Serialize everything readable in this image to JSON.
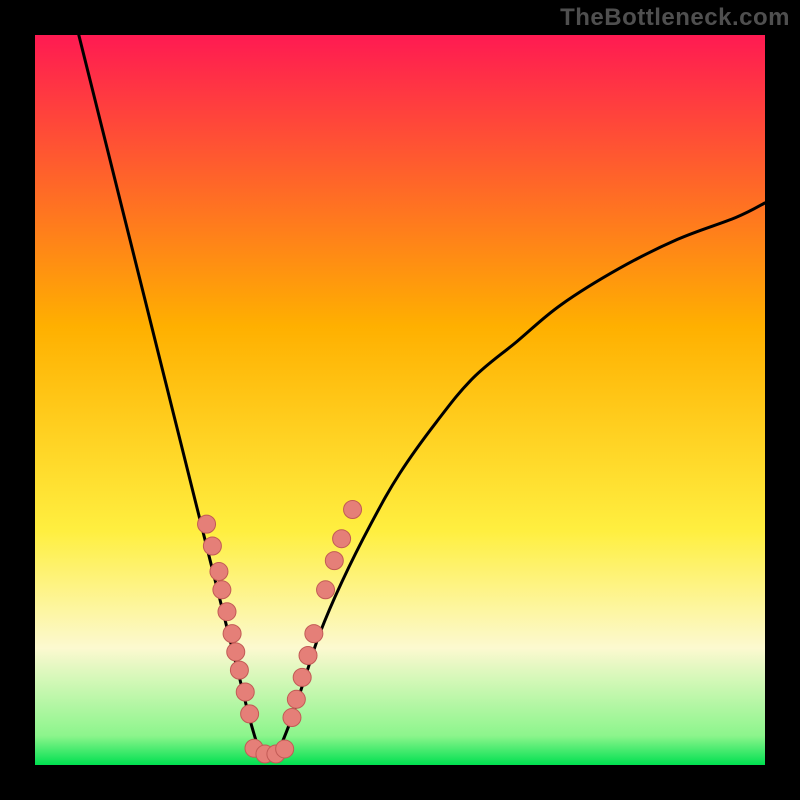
{
  "watermark": "TheBottleneck.com",
  "colors": {
    "frame": "#000000",
    "gradient_top": "#ff1a52",
    "gradient_mid": "#ffb000",
    "gradient_yellow": "#ffef40",
    "gradient_pale": "#fcf9d0",
    "gradient_green": "#00ea55",
    "curve": "#000000",
    "dot_fill": "#e57f78",
    "dot_stroke": "#c25a55"
  },
  "chart_data": {
    "type": "line",
    "title": "",
    "xlabel": "",
    "ylabel": "",
    "xlim": [
      0,
      100
    ],
    "ylim": [
      0,
      100
    ],
    "left_curve": {
      "comment": "descending branch, x is % across inner plot, y is % bottleneck (100=top)",
      "points": [
        [
          6,
          100
        ],
        [
          8,
          92
        ],
        [
          10,
          84
        ],
        [
          12,
          76
        ],
        [
          14,
          68
        ],
        [
          16,
          60
        ],
        [
          18,
          52
        ],
        [
          20,
          44
        ],
        [
          22,
          36
        ],
        [
          24,
          28
        ],
        [
          26,
          20
        ],
        [
          28,
          12
        ],
        [
          29.5,
          6
        ],
        [
          31,
          1
        ]
      ]
    },
    "right_curve": {
      "comment": "ascending branch",
      "points": [
        [
          33,
          1
        ],
        [
          35,
          6
        ],
        [
          37,
          12
        ],
        [
          39,
          18
        ],
        [
          42,
          25
        ],
        [
          46,
          33
        ],
        [
          50,
          40
        ],
        [
          55,
          47
        ],
        [
          60,
          53
        ],
        [
          66,
          58
        ],
        [
          72,
          63
        ],
        [
          80,
          68
        ],
        [
          88,
          72
        ],
        [
          96,
          75
        ],
        [
          100,
          77
        ]
      ]
    },
    "highlight_dots": {
      "comment": "salmon marker clusters near the valley, (x%,y%)",
      "points": [
        [
          23.5,
          33
        ],
        [
          24.3,
          30
        ],
        [
          25.2,
          26.5
        ],
        [
          25.6,
          24
        ],
        [
          26.3,
          21
        ],
        [
          27.0,
          18
        ],
        [
          27.5,
          15.5
        ],
        [
          28.0,
          13
        ],
        [
          28.8,
          10
        ],
        [
          29.4,
          7
        ],
        [
          30.0,
          2.3
        ],
        [
          31.5,
          1.5
        ],
        [
          33.0,
          1.5
        ],
        [
          34.2,
          2.2
        ],
        [
          35.2,
          6.5
        ],
        [
          35.8,
          9
        ],
        [
          36.6,
          12
        ],
        [
          37.4,
          15
        ],
        [
          38.2,
          18
        ],
        [
          39.8,
          24
        ],
        [
          41.0,
          28
        ],
        [
          42.0,
          31
        ],
        [
          43.5,
          35
        ]
      ]
    },
    "gradient_stops_pct": [
      {
        "offset": 0,
        "color": "#ff1a52"
      },
      {
        "offset": 40,
        "color": "#ffb000"
      },
      {
        "offset": 68,
        "color": "#ffef40"
      },
      {
        "offset": 84,
        "color": "#fcf9d0"
      },
      {
        "offset": 96,
        "color": "#8cf58c"
      },
      {
        "offset": 100,
        "color": "#00e050"
      }
    ]
  }
}
